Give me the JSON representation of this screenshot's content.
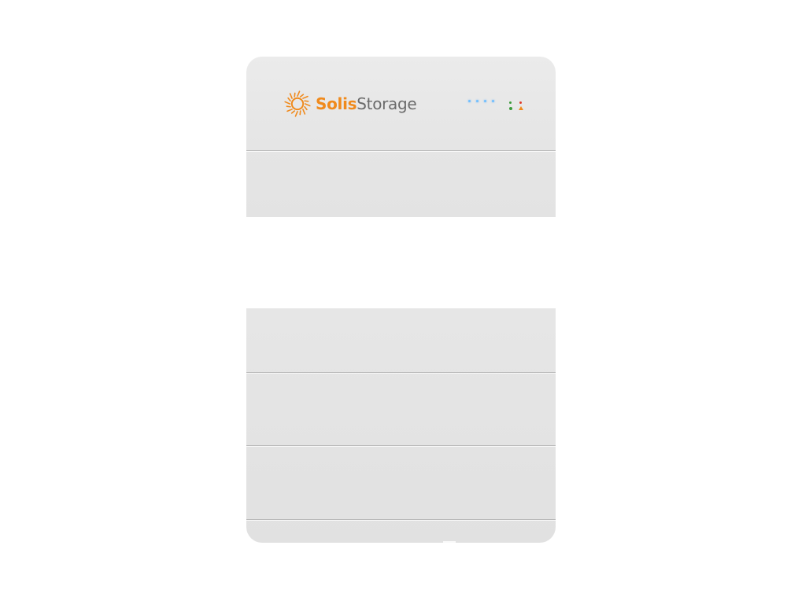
{
  "product": {
    "brand_primary": "Solis",
    "brand_secondary": "Storage"
  },
  "colors": {
    "brand_orange": "#f08a1c",
    "brand_gray": "#6b6b6b",
    "led_blue": "#6fbfff",
    "run_green": "#3a9a3a",
    "alarm_red": "#e03a2a",
    "alarm_orange": "#f08a1c"
  },
  "icons": {
    "logo": "sun-logo-icon",
    "alarm": "warning-triangle-icon"
  },
  "indicators": {
    "soc_leds_lit": 4
  }
}
